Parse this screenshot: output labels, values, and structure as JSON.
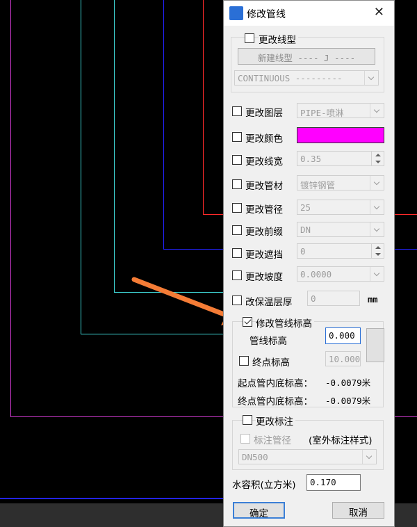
{
  "colors": {
    "canvas": "#000000",
    "accent_color_swatch": "#ff00ff",
    "cyan_line": "#3fd8d8",
    "blue_line": "#2323ff",
    "red_line": "#ff2a2a",
    "magenta_line": "#d23ad2",
    "arrow": "#f47c36"
  },
  "dialog": {
    "title": "修改管线",
    "linetype": {
      "label": "更改线型",
      "new_button": "新建线型 ---- J ----",
      "combo_value": "CONTINUOUS ---------"
    },
    "rows": [
      {
        "label": "更改图层",
        "value": "PIPE-喷淋",
        "kind": "combo"
      },
      {
        "label": "更改颜色",
        "value": "",
        "kind": "color"
      },
      {
        "label": "更改线宽",
        "value": "0.35",
        "kind": "spin"
      },
      {
        "label": "更改管材",
        "value": "镀锌钢管",
        "kind": "combo"
      },
      {
        "label": "更改管径",
        "value": "25",
        "kind": "combo"
      },
      {
        "label": "更改前缀",
        "value": "DN",
        "kind": "combo"
      },
      {
        "label": "更改遮挡",
        "value": "0",
        "kind": "spin"
      },
      {
        "label": "更改坡度",
        "value": "0.0000",
        "kind": "combo"
      }
    ],
    "insulation": {
      "label": "改保温层厚",
      "value": "0",
      "unit": "mm"
    },
    "elevation": {
      "label": "修改管线标高",
      "pipe_elev_label": "管线标高",
      "pipe_elev_value": "0.000",
      "end_elev_label": "终点标高",
      "end_elev_value": "10.000",
      "start_bottom_label": "起点管内底标高：",
      "start_bottom_value": "-0.0079米",
      "end_bottom_label": "终点管内底标高：",
      "end_bottom_value": "-0.0079米"
    },
    "annotation": {
      "label": "更改标注",
      "sub_label": "标注管径",
      "style_note": "(室外标注样式)",
      "combo_value": "DN500"
    },
    "volume": {
      "label": "水容积(立方米)",
      "value": "0.170"
    },
    "ok": "确定",
    "cancel": "取消"
  }
}
